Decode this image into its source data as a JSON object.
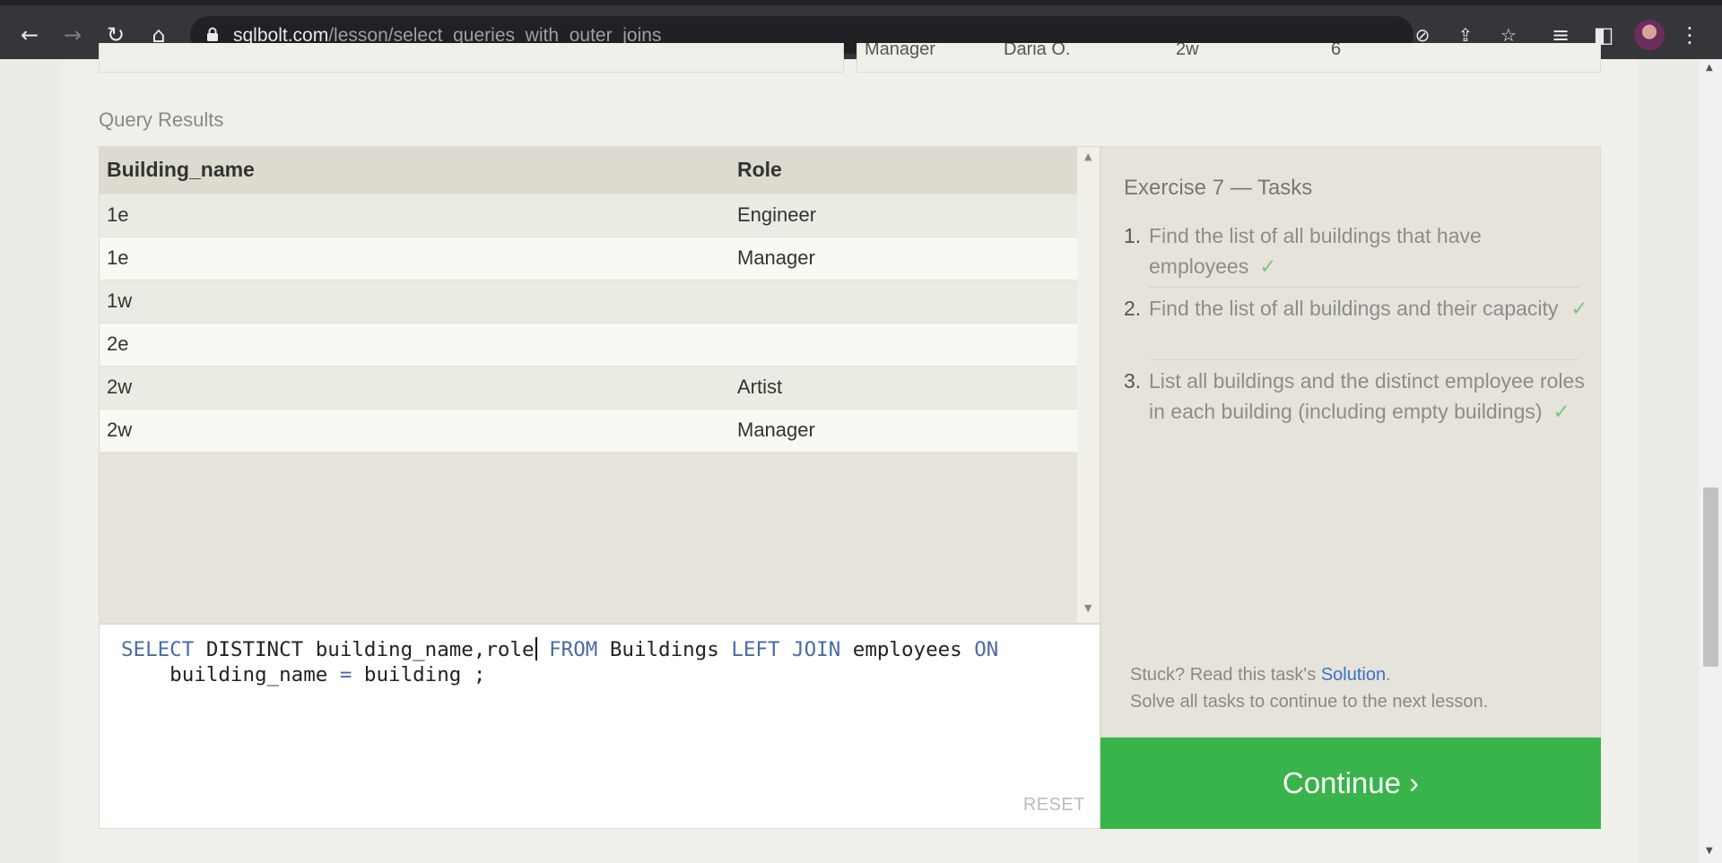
{
  "browser": {
    "url_domain": "sqlbolt.com",
    "url_path": "/lesson/select_queries_with_outer_joins"
  },
  "prev_table_fragment": [
    "Manager",
    "Daria O.",
    "2w",
    "6"
  ],
  "query_results": {
    "label": "Query Results",
    "columns": [
      "Building_name",
      "Role"
    ],
    "rows": [
      [
        "1e",
        "Engineer"
      ],
      [
        "1e",
        "Manager"
      ],
      [
        "1w",
        ""
      ],
      [
        "2e",
        ""
      ],
      [
        "2w",
        "Artist"
      ],
      [
        "2w",
        "Manager"
      ]
    ]
  },
  "editor": {
    "line1": {
      "kw1": "SELECT",
      "t1": " DISTINCT building_name,role",
      "kw2": " FROM",
      "t2": " Buildings ",
      "kw3": "LEFT JOIN",
      "t3": " employees ",
      "kw4": "ON"
    },
    "line2": {
      "t1": "    building_name ",
      "op": "=",
      "t2": " building ;"
    },
    "reset_label": "RESET"
  },
  "tasks": {
    "title": "Exercise 7 — Tasks",
    "items": [
      {
        "num": "1.",
        "text": "Find the list of all buildings that have employees",
        "check": "✓"
      },
      {
        "num": "2.",
        "text": "Find the list of all buildings and their capacity",
        "check": "✓"
      },
      {
        "num": "3.",
        "text": "List all buildings and the distinct employee roles in each building (including empty buildings)",
        "check": "✓"
      }
    ],
    "stuck_prefix": "Stuck? Read this task's ",
    "solution_link": "Solution",
    "stuck_suffix": ".",
    "solve_all": "Solve all tasks to continue to the next lesson."
  },
  "continue_label": "Continue ›"
}
